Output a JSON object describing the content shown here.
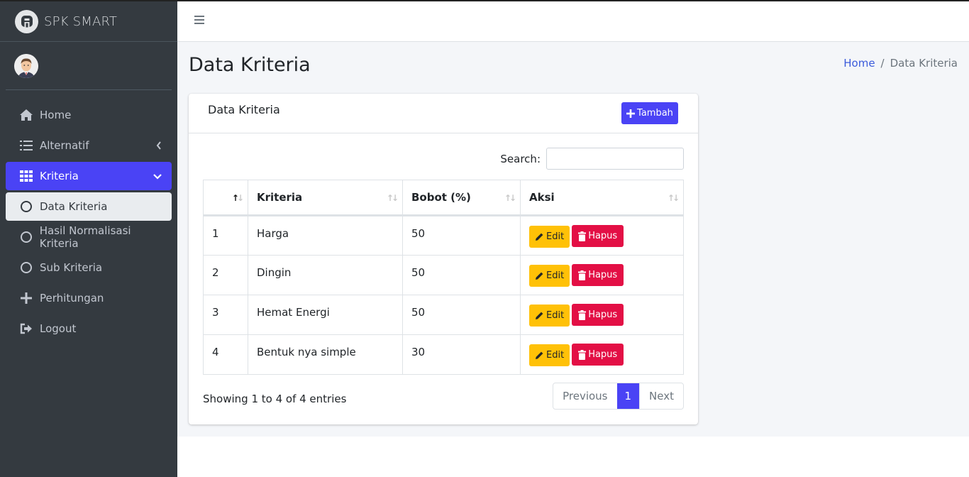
{
  "brand": {
    "name": "SPK SMART"
  },
  "sidebar": {
    "items": [
      {
        "label": "Home",
        "icon": "home-icon"
      },
      {
        "label": "Alternatif",
        "icon": "list-icon"
      },
      {
        "label": "Kriteria",
        "icon": "grid-icon"
      },
      {
        "label": "Data Kriteria",
        "icon": "circle-icon"
      },
      {
        "label": "Hasil Normalisasi Kriteria",
        "icon": "circle-icon"
      },
      {
        "label": "Sub Kriteria",
        "icon": "circle-icon"
      },
      {
        "label": "Perhitungan",
        "icon": "plus-icon"
      },
      {
        "label": "Logout",
        "icon": "logout-icon"
      }
    ]
  },
  "page": {
    "title": "Data Kriteria",
    "breadcrumb": {
      "home": "Home",
      "separator": "/",
      "current": "Data Kriteria"
    }
  },
  "card": {
    "title": "Data Kriteria",
    "add_label": "Tambah",
    "search_label": "Search:",
    "search_value": ""
  },
  "table": {
    "headers": [
      "",
      "Kriteria",
      "Bobot (%)",
      "Aksi"
    ],
    "rows": [
      {
        "no": "1",
        "kriteria": "Harga",
        "bobot": "50"
      },
      {
        "no": "2",
        "kriteria": "Dingin",
        "bobot": "50"
      },
      {
        "no": "3",
        "kriteria": "Hemat Energi",
        "bobot": "50"
      },
      {
        "no": "4",
        "kriteria": "Bentuk nya simple",
        "bobot": "30"
      }
    ],
    "edit_label": "Edit",
    "delete_label": "Hapus",
    "info": "Showing 1 to 4 of 4 entries",
    "pagination": {
      "previous": "Previous",
      "page": "1",
      "next": "Next"
    }
  },
  "colors": {
    "sidebar": "#343a40",
    "accent": "#4a43f5",
    "edit": "#ffc107",
    "delete": "#e30f45"
  }
}
